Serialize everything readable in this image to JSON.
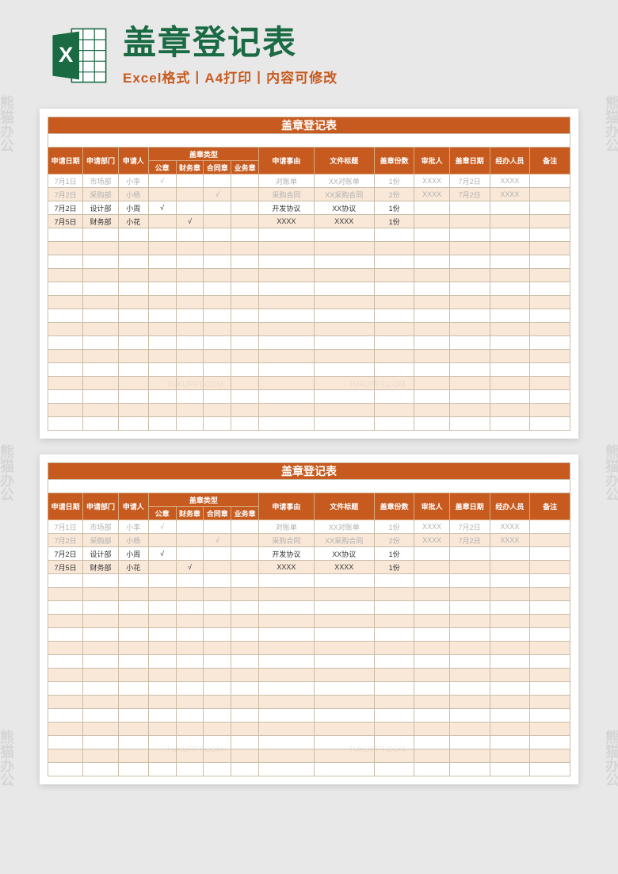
{
  "header": {
    "title": "盖章登记表",
    "subtitle": "Excel格式丨A4打印丨内容可修改",
    "iconLetter": "X"
  },
  "watermark": {
    "text": "熊猫办公",
    "url": "TUKUPPT.COM"
  },
  "table": {
    "title": "盖章登记表",
    "stampTypeGroup": "盖章类型",
    "columns": {
      "date": "申请日期",
      "dept": "申请部门",
      "person": "申请人",
      "stamp1": "公章",
      "stamp2": "财务章",
      "stamp3": "合同章",
      "stamp4": "业务章",
      "reason": "申请事由",
      "docTitle": "文件标题",
      "copies": "盖章份数",
      "approver": "审批人",
      "stampDate": "盖章日期",
      "handler": "经办人员",
      "remark": "备注"
    },
    "rows": [
      {
        "date": "7月1日",
        "dept": "市场部",
        "person": "小李",
        "s1": "√",
        "s2": "",
        "s3": "",
        "s4": "",
        "reason": "对账单",
        "title": "XX对账单",
        "copies": "1份",
        "approver": "XXXX",
        "sdate": "7月2日",
        "handler": "XXXX",
        "remark": "",
        "muted": true
      },
      {
        "date": "7月2日",
        "dept": "采购部",
        "person": "小杨",
        "s1": "",
        "s2": "",
        "s3": "√",
        "s4": "",
        "reason": "采购合同",
        "title": "XX采购合同",
        "copies": "2份",
        "approver": "XXXX",
        "sdate": "7月2日",
        "handler": "XXXX",
        "remark": "",
        "muted": true
      },
      {
        "date": "7月2日",
        "dept": "设计部",
        "person": "小周",
        "s1": "√",
        "s2": "",
        "s3": "",
        "s4": "",
        "reason": "开发协议",
        "title": "XX协议",
        "copies": "1份",
        "approver": "",
        "sdate": "",
        "handler": "",
        "remark": "",
        "muted": false
      },
      {
        "date": "7月5日",
        "dept": "财务部",
        "person": "小花",
        "s1": "",
        "s2": "√",
        "s3": "",
        "s4": "",
        "reason": "XXXX",
        "title": "XXXX",
        "copies": "1份",
        "approver": "",
        "sdate": "",
        "handler": "",
        "remark": "",
        "muted": false
      }
    ],
    "emptyRows": 15
  }
}
